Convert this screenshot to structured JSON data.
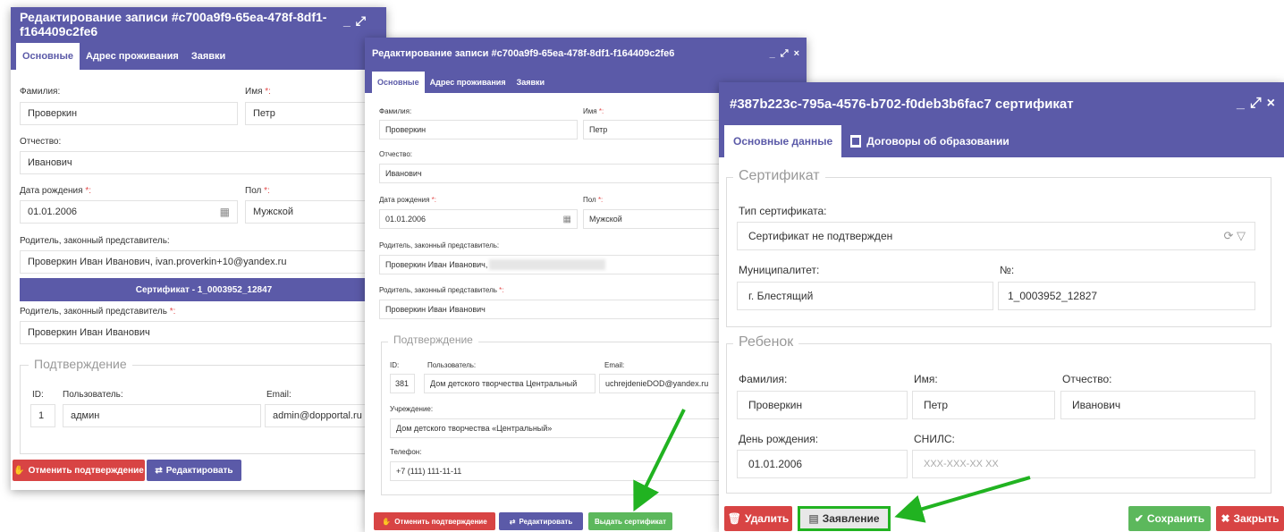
{
  "win1": {
    "title": "Редактирование записи #c700a9f9-65ea-478f-8df1-f164409c2fe6",
    "controls": [
      "_",
      "⤢",
      "×"
    ],
    "tabs": [
      "Основные",
      "Адрес проживания",
      "Заявки"
    ],
    "lastname_label": "Фамилия:",
    "lastname_value": "Проверкин",
    "firstname_label": "Имя",
    "firstname_value": "Петр",
    "middlename_label": "Отчество:",
    "middlename_value": "Иванович",
    "birth_label": "Дата рождения",
    "birth_value": "01.01.2006",
    "sex_label": "Пол",
    "sex_value": "Мужской",
    "parent_label": "Родитель, законный представитель:",
    "parent_value": "Проверкин Иван Иванович, ivan.proverkin+10@yandex.ru",
    "cert_button": "Сертификат - 1_0003952_12847",
    "parent2_label": "Родитель, законный представитель",
    "parent2_value": "Проверкин Иван Иванович",
    "confirm_legend": "Подтверждение",
    "id_label": "ID:",
    "id_value": "1",
    "user_label": "Пользователь:",
    "user_value": "админ",
    "email_label": "Email:",
    "email_value": "admin@dopportal.ru",
    "cancel_button": "Отменить подтверждение",
    "edit_button": "Редактировать"
  },
  "win2": {
    "title": "Редактирование записи #c700a9f9-65ea-478f-8df1-f164409c2fe6",
    "controls": [
      "_",
      "⤢",
      "×"
    ],
    "tabs": [
      "Основные",
      "Адрес проживания",
      "Заявки"
    ],
    "lastname_label": "Фамилия:",
    "lastname_value": "Проверкин",
    "firstname_label": "Имя",
    "firstname_value": "Петр",
    "middlename_label": "Отчество:",
    "middlename_value": "Иванович",
    "birth_label": "Дата рождения",
    "birth_value": "01.01.2006",
    "sex_label": "Пол",
    "sex_value": "Мужской",
    "parent_label": "Родитель, законный представитель:",
    "parent_value": "Проверкин Иван Иванович,",
    "parent2_label": "Родитель, законный представитель",
    "parent2_value": "Проверкин Иван Иванович",
    "confirm_legend": "Подтверждение",
    "id_label": "ID:",
    "id_value": "381",
    "user_label": "Пользователь:",
    "user_value": "Дом детского творчества Центральный",
    "email_label": "Email:",
    "email_value": "uchrejdenieDOD@yandex.ru",
    "org_label": "Учреждение:",
    "org_value": "Дом детского творчества «Центральный»",
    "phone_label": "Телефон:",
    "phone_value": "+7 (111) 111-11-11",
    "cancel_button": "Отменить подтверждение",
    "edit_button": "Редактировать",
    "issue_button": "Выдать сертификат"
  },
  "win3": {
    "title": "#387b223c-795a-4576-b702-f0deb3b6fac7 сертификат",
    "controls": [
      "_",
      "⤢",
      "×"
    ],
    "tabs": [
      "Основные данные",
      "Договоры об образовании"
    ],
    "cert_legend": "Сертификат",
    "type_label": "Тип сертификата:",
    "type_value": "Сертификат не подтвержден",
    "muni_label": "Муниципалитет:",
    "muni_value": "г. Блестящий",
    "num_label": "№:",
    "num_value": "1_0003952_12827",
    "child_legend": "Ребенок",
    "lastname_label": "Фамилия:",
    "lastname_value": "Проверкин",
    "firstname_label": "Имя:",
    "firstname_value": "Петр",
    "middlename_label": "Отчество:",
    "middlename_value": "Иванович",
    "birth_label": "День рождения:",
    "birth_value": "01.01.2006",
    "snils_label": "СНИЛС:",
    "snils_placeholder": "XXX-XXX-XX XX",
    "delete_button": "Удалить",
    "statement_button": "Заявление",
    "save_button": "Сохранить",
    "close_button": "Закрыть"
  },
  "required_mark": "*:",
  "colors": {
    "header": "#5b5aa8",
    "danger": "#d84444",
    "success": "#5cb85c",
    "highlight": "#21b321"
  }
}
